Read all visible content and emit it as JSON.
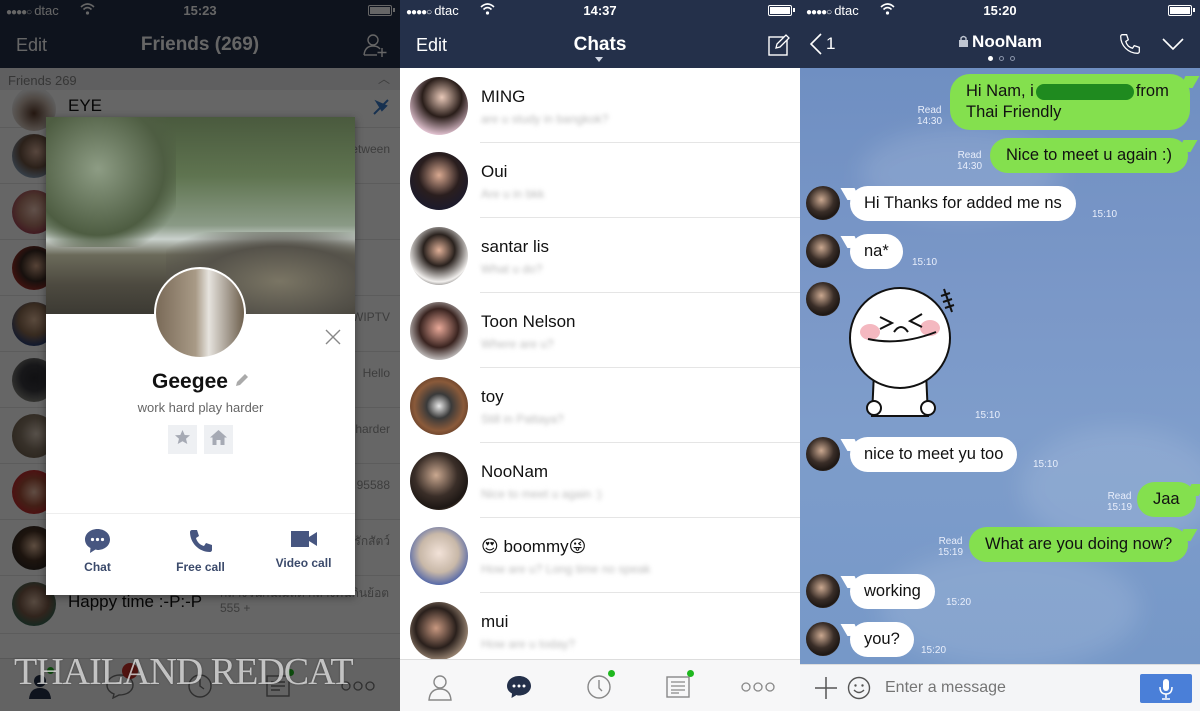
{
  "status_bars": [
    {
      "carrier": "dtac",
      "signal_dots": "●●●●○",
      "time": "15:23"
    },
    {
      "carrier": "dtac",
      "signal_dots": "●●●●○",
      "time": "14:37"
    },
    {
      "carrier": "dtac",
      "signal_dots": "●●●●○",
      "time": "15:20"
    }
  ],
  "friends_screen": {
    "nav": {
      "left": "Edit",
      "title": "Friends (269)",
      "right_icon": "add-friend-icon"
    },
    "section_header": "Friends 269",
    "friends": [
      {
        "name": "EYE",
        "status": ""
      },
      {
        "name": "",
        "status": "etween"
      },
      {
        "name": "",
        "status": ""
      },
      {
        "name": "",
        "status": ""
      },
      {
        "name": "",
        "status": "WIPTV"
      },
      {
        "name": "",
        "status": "Hello"
      },
      {
        "name": "",
        "status": "harder"
      },
      {
        "name": "",
        "status": "95588"
      },
      {
        "name": "",
        "status": "รักสัตว์"
      },
      {
        "name": "Happy time :-P:-P",
        "status": "กลางวันกินเมล็ด กลางคืนกินย้อต 555 +"
      }
    ],
    "profile_modal": {
      "name": "Geegee",
      "status_message": "work hard play harder",
      "actions": [
        {
          "label": "Chat",
          "icon": "chat-bubble-icon"
        },
        {
          "label": "Free call",
          "icon": "phone-icon"
        },
        {
          "label": "Video call",
          "icon": "video-camera-icon"
        }
      ]
    },
    "watermark": "THAILAND REDCAT"
  },
  "chats_screen": {
    "nav": {
      "left": "Edit",
      "title": "Chats",
      "right_icon": "compose-icon"
    },
    "chats": [
      {
        "name": "MING",
        "preview": "are u study in bangkok?"
      },
      {
        "name": "Oui",
        "preview": "Are u in bkk"
      },
      {
        "name": "santar lis",
        "preview": "What u do?"
      },
      {
        "name": "Toon Nelson",
        "preview": "Where are u?"
      },
      {
        "name": "toy",
        "preview": "Still in Pattaya?"
      },
      {
        "name": "NooNam",
        "preview": "Nice to meet u again :)"
      },
      {
        "name": "😍 boommy😜",
        "preview": "How are u? Long time no speak"
      },
      {
        "name": "mui",
        "preview": "How are u today?"
      }
    ],
    "tabs": [
      {
        "name": "friends",
        "icon": "person-icon",
        "active": false,
        "badge": false
      },
      {
        "name": "chats",
        "icon": "chat-bubble-icon",
        "active": true,
        "badge": false
      },
      {
        "name": "timeline",
        "icon": "clock-icon",
        "active": false,
        "badge": true
      },
      {
        "name": "news",
        "icon": "news-icon",
        "active": false,
        "badge": true
      },
      {
        "name": "more",
        "icon": "more-icon",
        "active": false,
        "badge": false
      }
    ]
  },
  "chatroom_screen": {
    "nav": {
      "back_count": "1",
      "title": "NooNam"
    },
    "messages": [
      {
        "from": "me",
        "text_before": "Hi Nam, i",
        "text_after": "from",
        "text_line2": "Thai Friendly",
        "read": "Read",
        "time": "14:30"
      },
      {
        "from": "me",
        "text": "Nice to meet u again :)",
        "read": "Read",
        "time": "14:30"
      },
      {
        "from": "them",
        "text": "Hi Thanks for added me ns",
        "time": "15:10"
      },
      {
        "from": "them",
        "text": "na*",
        "time": "15:10"
      },
      {
        "from": "them",
        "sticker": "line-moon-sticker",
        "time": "15:10"
      },
      {
        "from": "them",
        "text": "nice to meet yu too",
        "time": "15:10"
      },
      {
        "from": "me",
        "text": "Jaa",
        "read": "Read",
        "time": "15:19"
      },
      {
        "from": "me",
        "text": "What are you doing now?",
        "read": "Read",
        "time": "15:19"
      },
      {
        "from": "them",
        "text": "working",
        "time": "15:20"
      },
      {
        "from": "them",
        "text": "you?",
        "time": "15:20"
      }
    ],
    "input": {
      "placeholder": "Enter a message"
    }
  },
  "colors": {
    "navbar": "#24304a",
    "my_bubble": "#84e04e",
    "their_bubble": "#ffffff",
    "chat_bg": "#6f8fc2",
    "mic_button": "#4a7fd8",
    "badge_green": "#1fb81f"
  }
}
